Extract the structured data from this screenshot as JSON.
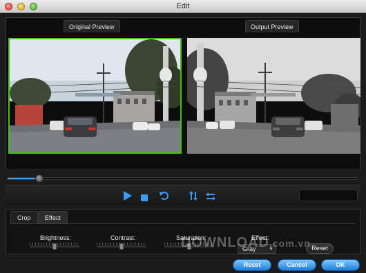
{
  "window": {
    "title": "Edit"
  },
  "preview": {
    "original_label": "Original Preview",
    "output_label": "Output Preview"
  },
  "progress": {
    "position_fraction": 0.09
  },
  "controls": {
    "play_icon": "play-icon",
    "stop_icon": "stop-icon",
    "rotate_icon": "rotate-icon",
    "flip_vertical_icon": "flip-vertical-icon",
    "flip_horizontal_icon": "flip-horizontal-icon"
  },
  "settings": {
    "tabs": [
      {
        "label": "Crop"
      },
      {
        "label": "Effect"
      }
    ],
    "active_tab": "Effect",
    "brightness": {
      "label": "Brightness:",
      "value_fraction": 0.5
    },
    "contrast": {
      "label": "Contrast:",
      "value_fraction": 0.5
    },
    "saturation": {
      "label": "Saturation:",
      "value_fraction": 0.5
    },
    "effect": {
      "label": "Effect:",
      "selected": "Gray"
    },
    "reset_label": "Reset"
  },
  "footer": {
    "reset_label": "Reset",
    "cancel_label": "Cancel",
    "ok_label": "OK"
  },
  "watermark": {
    "main": "DOWNLOAD",
    "suffix": ".com.vn"
  },
  "colors": {
    "accent_blue": "#1f7ed8",
    "original_border": "#43c21d"
  }
}
